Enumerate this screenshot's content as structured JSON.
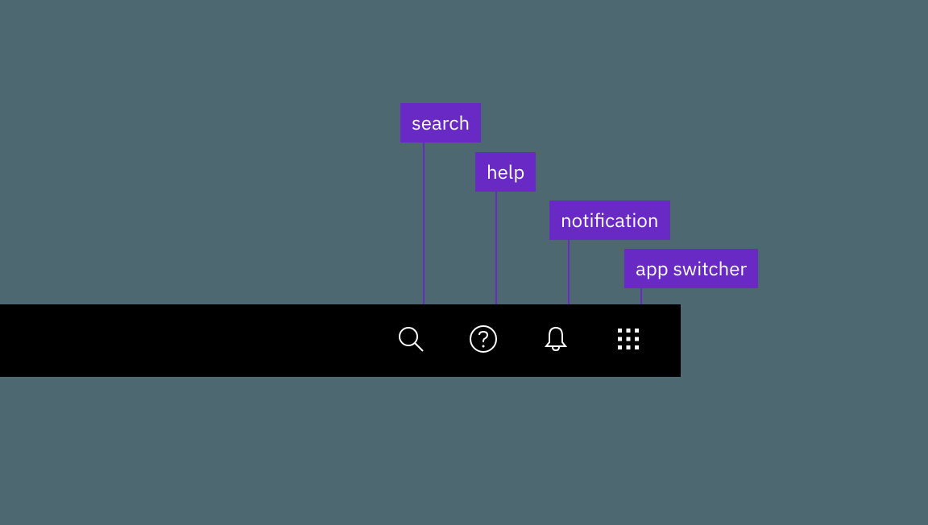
{
  "labels": {
    "search": "search",
    "help": "help",
    "notification": "notification",
    "app_switcher": "app switcher"
  },
  "icons": {
    "search": "search-icon",
    "help": "help-icon",
    "notification": "notification-icon",
    "app_switcher": "app-switcher-icon"
  },
  "colors": {
    "background": "#4d6870",
    "toolbar": "#000000",
    "label_bg": "#6929c4",
    "label_text": "#ffffff",
    "icon_stroke": "#ffffff"
  }
}
